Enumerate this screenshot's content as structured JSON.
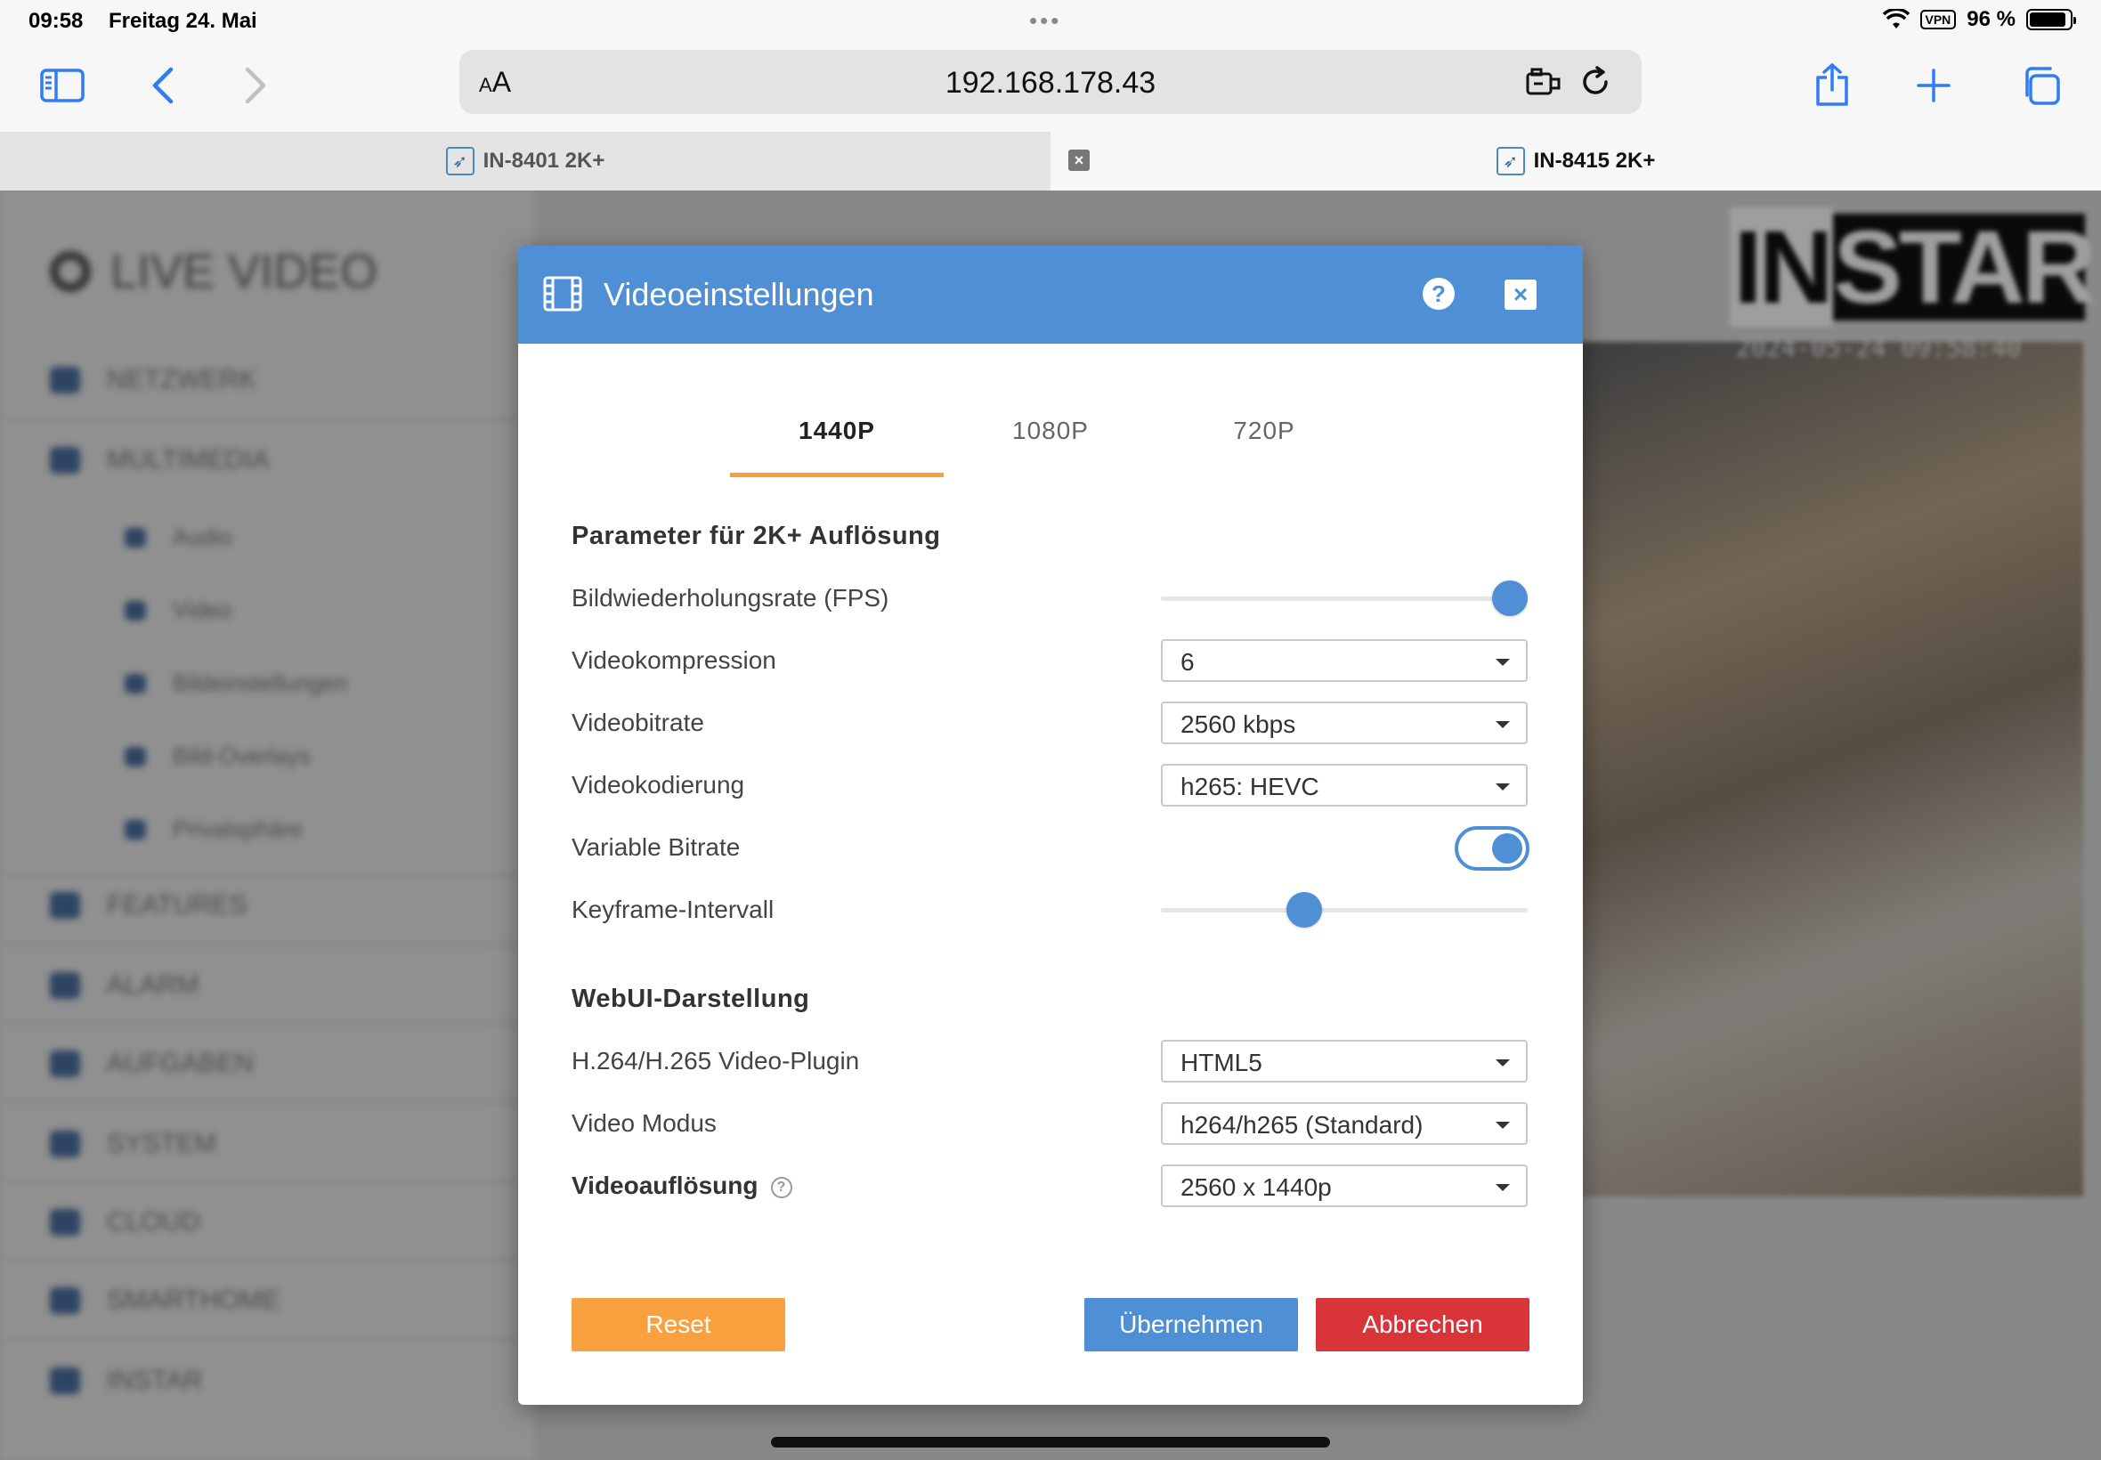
{
  "status": {
    "time": "09:58",
    "date": "Freitag 24. Mai",
    "vpn": "VPN",
    "battery": "96 %"
  },
  "browser": {
    "aa_small": "A",
    "aa_big": "A",
    "url": "192.168.178.43"
  },
  "tabs": [
    {
      "label": "IN-8401 2K+"
    },
    {
      "label": "IN-8415 2K+"
    }
  ],
  "sidebar": {
    "heading": "LIVE VIDEO",
    "items": [
      "NETZWERK",
      "MULTIMEDIA",
      "FEATURES",
      "ALARM",
      "AUFGABEN",
      "SYSTEM",
      "CLOUD",
      "SMARTHOME",
      "INSTAR"
    ],
    "subitems": [
      "Audio",
      "Video",
      "Bildeinstellungen",
      "Bild-Overlays",
      "Privatsphäre"
    ]
  },
  "camera": {
    "logo_a": "IN",
    "logo_b": "STAR",
    "timestamp": "2024-05-24 09:58:40"
  },
  "modal": {
    "title": "Videoeinstellungen",
    "help": "?",
    "close": "×",
    "tabs": [
      "1440P",
      "1080P",
      "720P"
    ],
    "section1": "Parameter für 2K+ Auflösung",
    "fps_label": "Bildwiederholungsrate (FPS)",
    "fps_level": 1.0,
    "compression_label": "Videokompression",
    "compression_value": "6",
    "bitrate_label": "Videobitrate",
    "bitrate_value": "2560 kbps",
    "encoding_label": "Videokodierung",
    "encoding_value": "h265: HEVC",
    "vbr_label": "Variable Bitrate",
    "vbr_on": true,
    "keyframe_label": "Keyframe-Intervall",
    "keyframe_level": 0.38,
    "section2": "WebUI-Darstellung",
    "plugin_label": "H.264/H.265 Video-Plugin",
    "plugin_value": "HTML5",
    "mode_label": "Video Modus",
    "mode_value": "h264/h265 (Standard)",
    "resolution_label": "Videoauflösung",
    "resolution_value": "2560 x 1440p",
    "reset": "Reset",
    "apply": "Übernehmen",
    "cancel": "Abbrechen"
  },
  "colors": {
    "accent": "#4f8fd6",
    "reset": "#f9a03f",
    "cancel": "#d9343a",
    "tab_underline": "#f5a13a"
  }
}
